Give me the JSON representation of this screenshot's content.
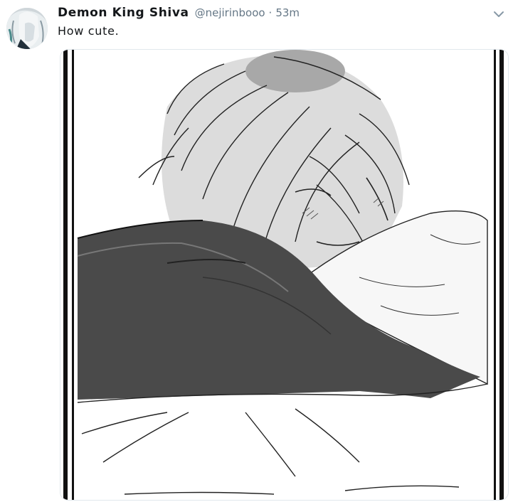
{
  "tweet": {
    "display_name": "Demon King Shiva",
    "handle": "@nejirinbooo",
    "separator": "·",
    "timestamp": "53m",
    "text": "How cute.",
    "avatar_icon": "user-avatar",
    "caret_icon": "chevron-down-icon",
    "media_icon": "manga-illustration"
  },
  "colors": {
    "name": "#14171a",
    "meta": "#657786",
    "caret": "#8899a6",
    "media_border": "#e1e8ed"
  }
}
